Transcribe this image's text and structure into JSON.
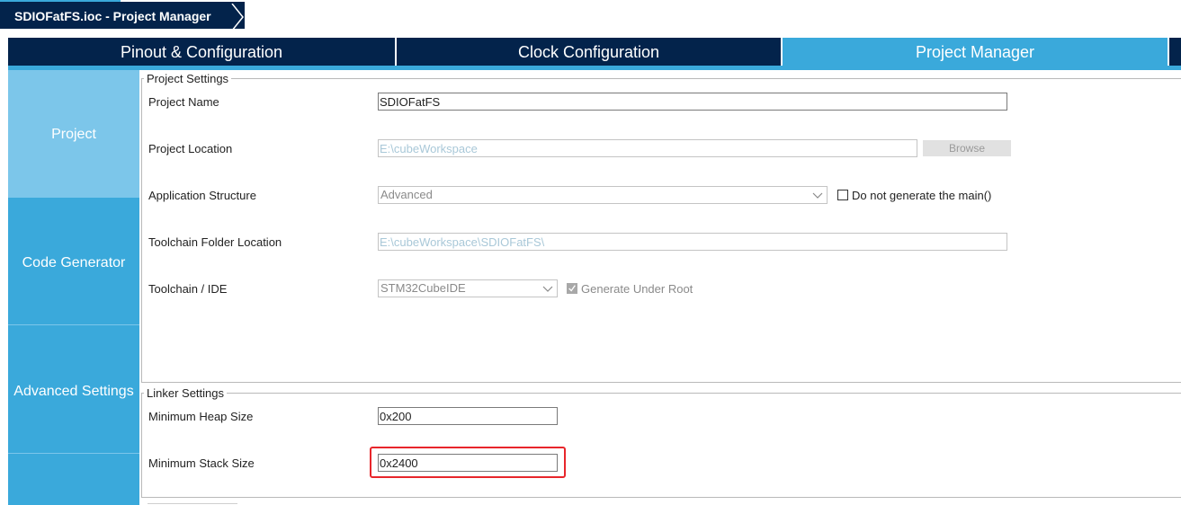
{
  "breadcrumb": {
    "text": "SDIOFatFS.ioc - Project Manager"
  },
  "tabs": [
    {
      "label": "Pinout & Configuration"
    },
    {
      "label": "Clock Configuration"
    },
    {
      "label": "Project Manager"
    }
  ],
  "sidenav": [
    {
      "label": "Project"
    },
    {
      "label": "Code Generator"
    },
    {
      "label": "Advanced Settings"
    }
  ],
  "project_settings": {
    "legend": "Project Settings",
    "project_name_label": "Project Name",
    "project_name_value": "SDIOFatFS",
    "project_location_label": "Project Location",
    "project_location_value": "E:\\cubeWorkspace",
    "browse_label": "Browse",
    "app_structure_label": "Application Structure",
    "app_structure_value": "Advanced",
    "no_main_label": "Do not generate the main()",
    "toolchain_folder_label": "Toolchain Folder Location",
    "toolchain_folder_value": "E:\\cubeWorkspace\\SDIOFatFS\\",
    "toolchain_ide_label": "Toolchain / IDE",
    "toolchain_ide_value": "STM32CubeIDE",
    "generate_under_root_label": "Generate Under Root"
  },
  "linker_settings": {
    "legend": "Linker Settings",
    "heap_label": "Minimum Heap Size",
    "heap_value": "0x200",
    "stack_label": "Minimum Stack Size",
    "stack_value": "0x2400"
  },
  "colors": {
    "navy": "#03234b",
    "accent": "#3aa9db",
    "nav_active": "#7cc6ea",
    "highlight": "#e8262b"
  }
}
